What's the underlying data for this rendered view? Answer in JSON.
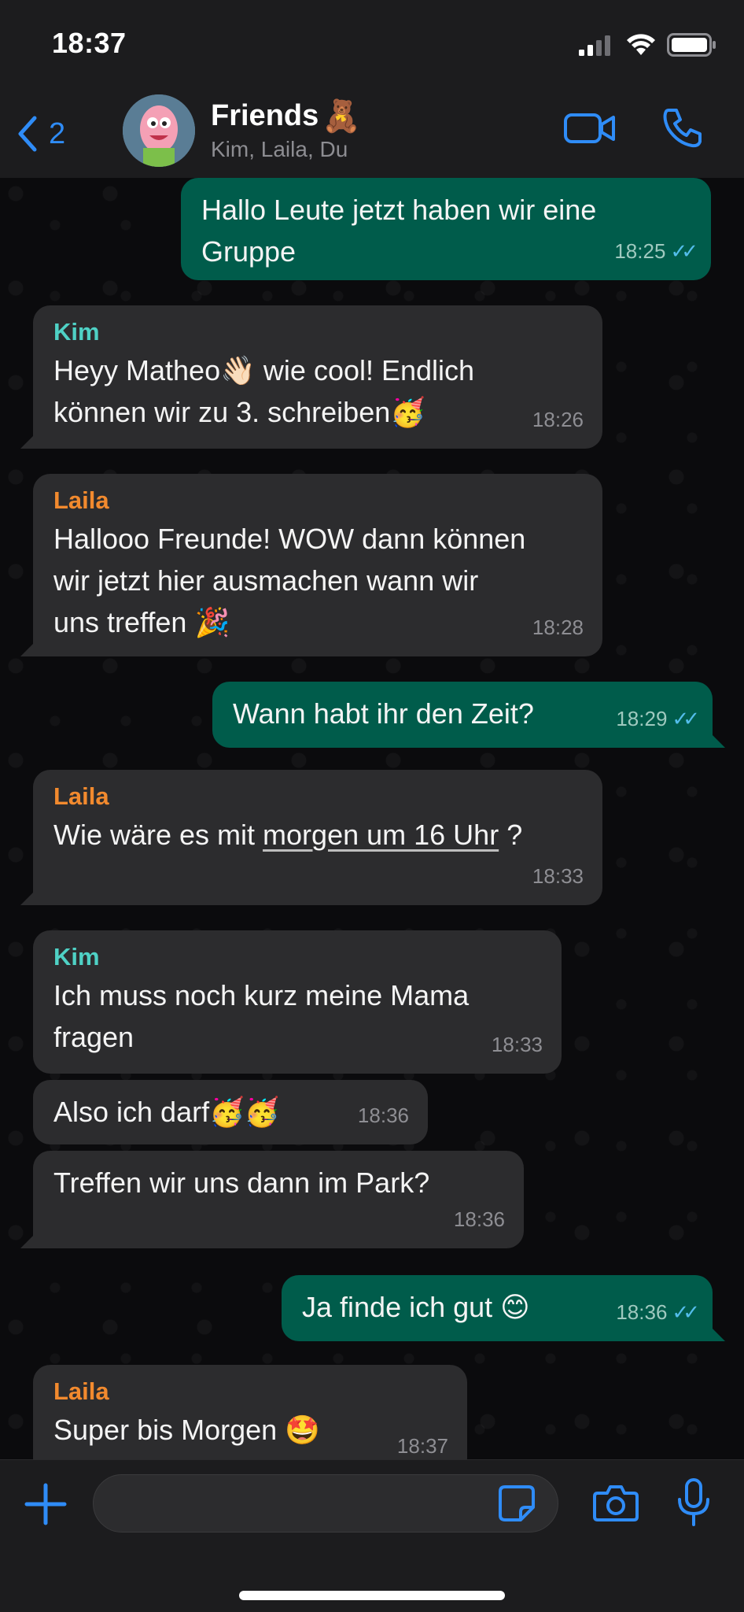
{
  "status_bar": {
    "time": "18:37"
  },
  "header": {
    "back_count": "2",
    "title": "Friends",
    "title_emoji": "🧸",
    "subtitle": "Kim, Laila, Du"
  },
  "messages": [
    {
      "text": "Hallo Leute jetzt haben wir eine\nGruppe",
      "time": "18:25",
      "read": "✓✓"
    },
    {
      "sender": "Kim",
      "text": "Heyy Matheo👋🏻 wie cool! Endlich\nkönnen wir zu 3. schreiben🥳",
      "time": "18:26"
    },
    {
      "sender": "Laila",
      "text": "Hallooo Freunde! WOW dann können\nwir jetzt hier ausmachen wann wir\nuns treffen  🎉",
      "time": "18:28"
    },
    {
      "text": "Wann habt ihr den Zeit?",
      "time": "18:29",
      "read": "✓✓"
    },
    {
      "sender": "Laila",
      "text_before": "Wie wäre es mit ",
      "link": "morgen um 16 Uhr",
      "text_after": " ?",
      "time": "18:33"
    },
    {
      "sender": "Kim",
      "text": "Ich muss noch kurz meine Mama\nfragen",
      "time": "18:33"
    },
    {
      "text": "Also ich darf🥳🥳",
      "time": "18:36"
    },
    {
      "text": "Treffen wir uns dann im Park?",
      "time": "18:36"
    },
    {
      "text": "Ja finde ich gut 😊",
      "time": "18:36",
      "read": "✓✓"
    },
    {
      "sender": "Laila",
      "text": "Super bis Morgen 🤩",
      "time": "18:37"
    }
  ],
  "icons": {
    "back": "chevron-left-icon",
    "video": "video-camera-icon",
    "call": "phone-icon",
    "plus": "plus-icon",
    "sticker": "sticker-icon",
    "camera": "camera-icon",
    "mic": "microphone-icon"
  },
  "colors": {
    "accent": "#2f8cf7",
    "outgoing_bubble": "#005c4b",
    "incoming_bubble": "#2c2c2e",
    "sender_kim": "#4fd1c5",
    "sender_laila": "#f28a2e",
    "read_ticks": "#53bdeb"
  }
}
